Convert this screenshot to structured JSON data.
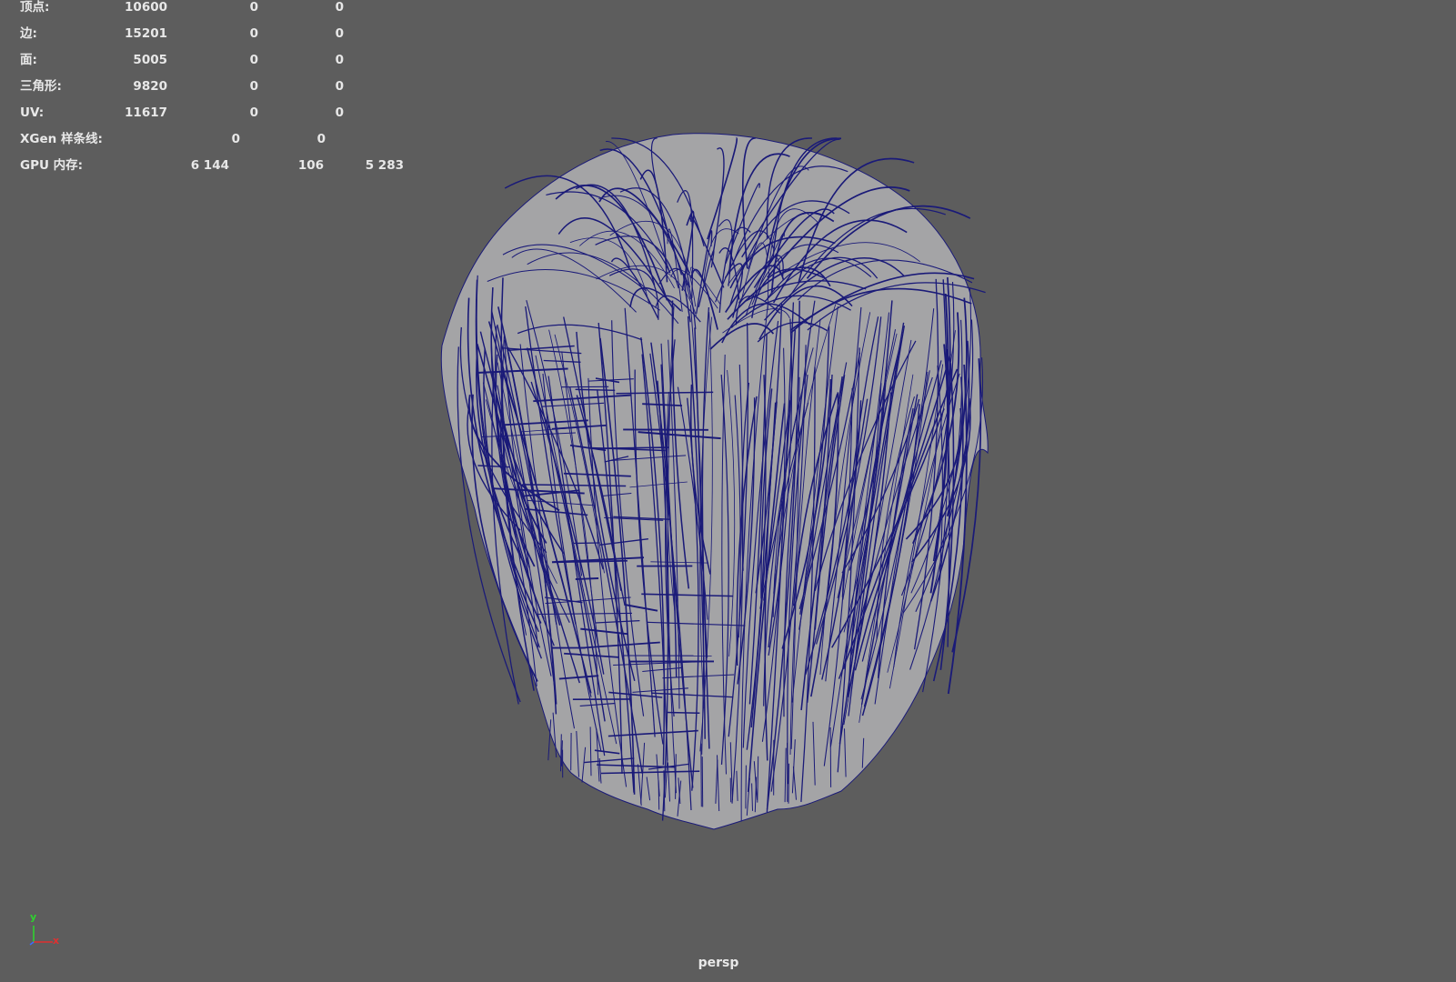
{
  "hud": {
    "vertices": {
      "label": "顶点:",
      "v1": "10600",
      "v2": "0",
      "v3": "0"
    },
    "edges": {
      "label": "边:",
      "v1": "15201",
      "v2": "0",
      "v3": "0"
    },
    "faces": {
      "label": "面:",
      "v1": "5005",
      "v2": "0",
      "v3": "0"
    },
    "triangles": {
      "label": "三角形:",
      "v1": "9820",
      "v2": "0",
      "v3": "0"
    },
    "uvs": {
      "label": "UV:",
      "v1": "11617",
      "v2": "0",
      "v3": "0"
    },
    "xgen": {
      "label": "XGen 样条线:",
      "v1": "0",
      "v2": "0"
    },
    "gpu": {
      "label": "GPU 内存:",
      "v1": "6 144",
      "v2": "106",
      "v3": "5 283"
    }
  },
  "axis": {
    "y": "y",
    "x": "x",
    "y_color": "#2fd12f",
    "x_color": "#e03030",
    "z_color": "#3a6cff"
  },
  "camera": "persp",
  "colors": {
    "background": "#5d5d5d",
    "mesh_fill": "#a4a4a6",
    "wireframe": "#1a1a78"
  }
}
